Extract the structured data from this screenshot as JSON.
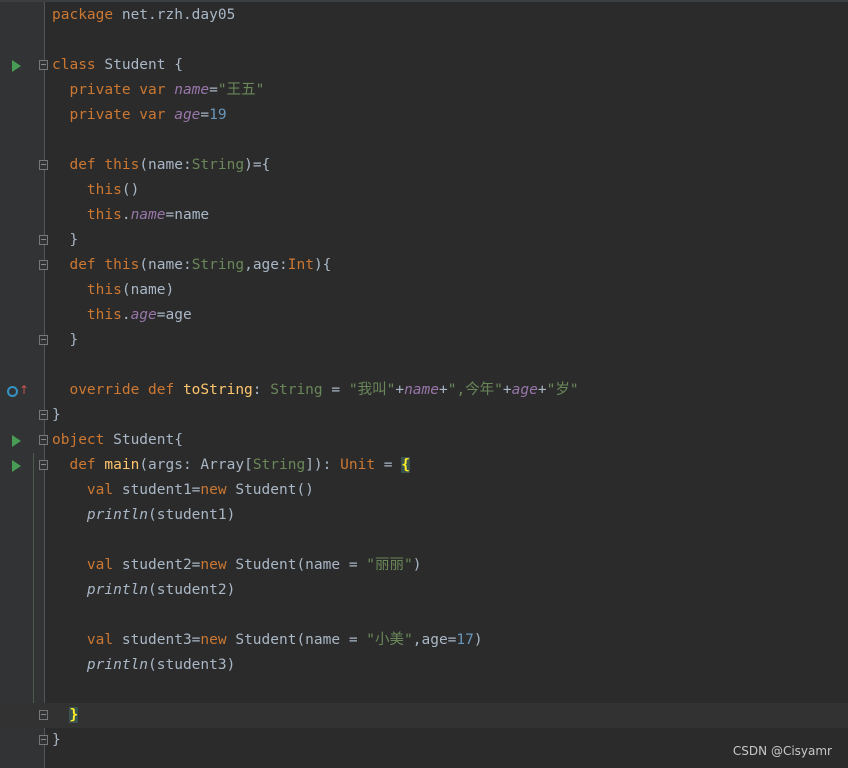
{
  "editor": {
    "lines": [
      {
        "icon": "",
        "fold": false,
        "segments": [
          {
            "t": "package ",
            "c": "kw"
          },
          {
            "t": "net.rzh.day05",
            "c": "plain"
          }
        ]
      },
      {
        "icon": "",
        "fold": false,
        "segments": []
      },
      {
        "icon": "run",
        "fold": true,
        "segments": [
          {
            "t": "class ",
            "c": "kw"
          },
          {
            "t": "Student {",
            "c": "plain"
          }
        ]
      },
      {
        "icon": "",
        "fold": false,
        "segments": [
          {
            "t": "  private var ",
            "c": "kw"
          },
          {
            "t": "name",
            "c": "fld"
          },
          {
            "t": "=",
            "c": "plain"
          },
          {
            "t": "\"王五\"",
            "c": "str"
          }
        ]
      },
      {
        "icon": "",
        "fold": false,
        "segments": [
          {
            "t": "  private var ",
            "c": "kw"
          },
          {
            "t": "age",
            "c": "fld"
          },
          {
            "t": "=",
            "c": "plain"
          },
          {
            "t": "19",
            "c": "num"
          }
        ]
      },
      {
        "icon": "",
        "fold": false,
        "segments": []
      },
      {
        "icon": "",
        "fold": true,
        "segments": [
          {
            "t": "  def ",
            "c": "kw"
          },
          {
            "t": "this",
            "c": "kw"
          },
          {
            "t": "(name:",
            "c": "plain"
          },
          {
            "t": "String",
            "c": "str"
          },
          {
            "t": ")={",
            "c": "plain"
          }
        ]
      },
      {
        "icon": "",
        "fold": false,
        "segments": [
          {
            "t": "    this",
            "c": "kw"
          },
          {
            "t": "()",
            "c": "plain"
          }
        ]
      },
      {
        "icon": "",
        "fold": false,
        "segments": [
          {
            "t": "    this",
            "c": "kw"
          },
          {
            "t": ".",
            "c": "plain"
          },
          {
            "t": "name",
            "c": "fld"
          },
          {
            "t": "=name",
            "c": "plain"
          }
        ]
      },
      {
        "icon": "",
        "fold": true,
        "segments": [
          {
            "t": "  }",
            "c": "plain"
          }
        ]
      },
      {
        "icon": "",
        "fold": true,
        "segments": [
          {
            "t": "  def ",
            "c": "kw"
          },
          {
            "t": "this",
            "c": "kw"
          },
          {
            "t": "(name:",
            "c": "plain"
          },
          {
            "t": "String",
            "c": "str"
          },
          {
            "t": ",age:",
            "c": "plain"
          },
          {
            "t": "Int",
            "c": "kw"
          },
          {
            "t": "){",
            "c": "plain"
          }
        ]
      },
      {
        "icon": "",
        "fold": false,
        "segments": [
          {
            "t": "    this",
            "c": "kw"
          },
          {
            "t": "(name)",
            "c": "plain"
          }
        ]
      },
      {
        "icon": "",
        "fold": false,
        "segments": [
          {
            "t": "    this",
            "c": "kw"
          },
          {
            "t": ".",
            "c": "plain"
          },
          {
            "t": "age",
            "c": "fld"
          },
          {
            "t": "=age",
            "c": "plain"
          }
        ]
      },
      {
        "icon": "",
        "fold": true,
        "segments": [
          {
            "t": "  }",
            "c": "plain"
          }
        ]
      },
      {
        "icon": "",
        "fold": false,
        "segments": []
      },
      {
        "icon": "override",
        "fold": false,
        "segments": [
          {
            "t": "  override def ",
            "c": "kw"
          },
          {
            "t": "toString",
            "c": "fn"
          },
          {
            "t": ": ",
            "c": "plain"
          },
          {
            "t": "String",
            "c": "str"
          },
          {
            "t": " = ",
            "c": "plain"
          },
          {
            "t": "\"我叫\"",
            "c": "str"
          },
          {
            "t": "+",
            "c": "plain"
          },
          {
            "t": "name",
            "c": "fld"
          },
          {
            "t": "+",
            "c": "plain"
          },
          {
            "t": "\",今年\"",
            "c": "str"
          },
          {
            "t": "+",
            "c": "plain"
          },
          {
            "t": "age",
            "c": "fld"
          },
          {
            "t": "+",
            "c": "plain"
          },
          {
            "t": "\"岁\"",
            "c": "str"
          }
        ]
      },
      {
        "icon": "",
        "fold": true,
        "segments": [
          {
            "t": "}",
            "c": "plain"
          }
        ]
      },
      {
        "icon": "run",
        "fold": true,
        "segments": [
          {
            "t": "object ",
            "c": "kw"
          },
          {
            "t": "Student{",
            "c": "plain"
          }
        ]
      },
      {
        "icon": "run",
        "fold": true,
        "segments": [
          {
            "t": "  def ",
            "c": "kw"
          },
          {
            "t": "main",
            "c": "fn"
          },
          {
            "t": "(args: Array[",
            "c": "plain"
          },
          {
            "t": "String",
            "c": "str"
          },
          {
            "t": "]): ",
            "c": "plain"
          },
          {
            "t": "Unit",
            "c": "kw"
          },
          {
            "t": " = ",
            "c": "plain"
          },
          {
            "t": "{",
            "c": "brace"
          }
        ]
      },
      {
        "icon": "",
        "fold": false,
        "segments": [
          {
            "t": "    val ",
            "c": "kw"
          },
          {
            "t": "student1=",
            "c": "plain"
          },
          {
            "t": "new ",
            "c": "kw"
          },
          {
            "t": "Student()",
            "c": "plain"
          }
        ]
      },
      {
        "icon": "",
        "fold": false,
        "segments": [
          {
            "t": "    println",
            "c": "ital"
          },
          {
            "t": "(student1)",
            "c": "plain"
          }
        ]
      },
      {
        "icon": "",
        "fold": false,
        "segments": []
      },
      {
        "icon": "",
        "fold": false,
        "segments": [
          {
            "t": "    val ",
            "c": "kw"
          },
          {
            "t": "student2=",
            "c": "plain"
          },
          {
            "t": "new ",
            "c": "kw"
          },
          {
            "t": "Student(name = ",
            "c": "plain"
          },
          {
            "t": "\"丽丽\"",
            "c": "str"
          },
          {
            "t": ")",
            "c": "plain"
          }
        ]
      },
      {
        "icon": "",
        "fold": false,
        "segments": [
          {
            "t": "    println",
            "c": "ital"
          },
          {
            "t": "(student2)",
            "c": "plain"
          }
        ]
      },
      {
        "icon": "",
        "fold": false,
        "segments": []
      },
      {
        "icon": "",
        "fold": false,
        "segments": [
          {
            "t": "    val ",
            "c": "kw"
          },
          {
            "t": "student3=",
            "c": "plain"
          },
          {
            "t": "new ",
            "c": "kw"
          },
          {
            "t": "Student(name = ",
            "c": "plain"
          },
          {
            "t": "\"小美\"",
            "c": "str"
          },
          {
            "t": ",age=",
            "c": "plain"
          },
          {
            "t": "17",
            "c": "num"
          },
          {
            "t": ")",
            "c": "plain"
          }
        ]
      },
      {
        "icon": "",
        "fold": false,
        "segments": [
          {
            "t": "    println",
            "c": "ital"
          },
          {
            "t": "(student3)",
            "c": "plain"
          }
        ]
      },
      {
        "icon": "",
        "fold": false,
        "segments": []
      },
      {
        "icon": "",
        "fold": true,
        "current": true,
        "segments": [
          {
            "t": "  ",
            "c": "plain"
          },
          {
            "t": "}",
            "c": "brace"
          }
        ]
      },
      {
        "icon": "",
        "fold": true,
        "segments": [
          {
            "t": "}",
            "c": "plain"
          }
        ]
      }
    ]
  },
  "colors": {
    "background": "#2b2b2b",
    "keyword": "#cc7832",
    "string": "#6a8759",
    "number": "#6897bb",
    "field": "#9876aa",
    "function": "#ffc66d",
    "plain": "#a9b7c6",
    "run_icon": "#499c54"
  },
  "watermark": "CSDN @Cisyamr"
}
